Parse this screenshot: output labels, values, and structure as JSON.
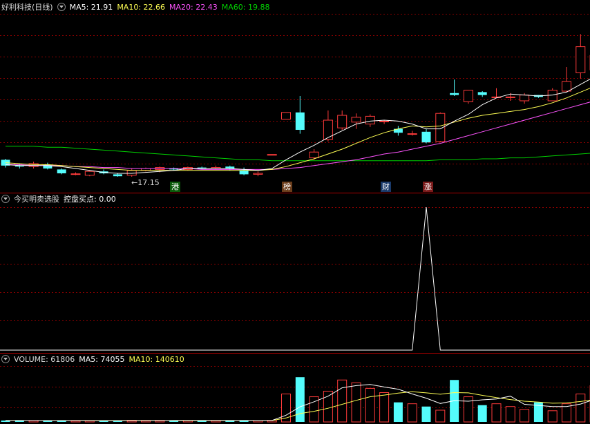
{
  "price_panel": {
    "title": "好利科技",
    "period": "(日线)",
    "ma5": "MA5: 21.91",
    "ma10": "MA10: 22.66",
    "ma20": "MA20: 22.43",
    "ma60": "MA60: 19.88",
    "low_label": "←17.15",
    "tags": [
      "港",
      "榜",
      "财",
      "涨"
    ]
  },
  "indicator_panel": {
    "name": "今买明卖选股",
    "value_label": "控盘买点: 0.00"
  },
  "volume_panel": {
    "volume": "VOLUME: 61806",
    "ma5": "MA5: 74055",
    "ma10": "MA10: 140610"
  },
  "colors": {
    "up": "#ff3b3b",
    "down": "#54fcfc",
    "ma5": "#ffffff",
    "ma10": "#ffff54",
    "ma20": "#ff54ff",
    "ma60": "#00d200",
    "grid": "#8a0000"
  },
  "chart_data": {
    "type": "candlestick",
    "ohlc": [
      [
        18.9,
        18.3,
        18.1,
        19.0
      ],
      [
        18.3,
        18.2,
        18.0,
        18.5
      ],
      [
        18.2,
        18.5,
        18.0,
        18.7
      ],
      [
        18.4,
        18.0,
        17.9,
        18.6
      ],
      [
        17.9,
        17.5,
        17.4,
        18.0
      ],
      [
        17.4,
        17.45,
        17.3,
        17.6
      ],
      [
        17.3,
        17.7,
        17.2,
        17.8
      ],
      [
        17.7,
        17.5,
        17.4,
        17.9
      ],
      [
        17.4,
        17.2,
        17.15,
        17.5
      ],
      [
        17.3,
        17.8,
        17.15,
        18.0
      ],
      [
        17.8,
        18.0,
        17.7,
        18.1
      ],
      [
        17.9,
        18.1,
        17.6,
        18.2
      ],
      [
        18.0,
        17.9,
        17.8,
        18.1
      ],
      [
        17.9,
        18.1,
        17.8,
        18.2
      ],
      [
        18.1,
        18.0,
        17.9,
        18.2
      ],
      [
        18.0,
        18.1,
        17.9,
        18.3
      ],
      [
        18.2,
        18.0,
        17.8,
        18.3
      ],
      [
        17.8,
        17.4,
        17.3,
        18.1
      ],
      [
        17.4,
        17.5,
        17.2,
        17.7
      ],
      [
        19.4,
        19.45,
        19.4,
        19.45
      ],
      [
        23.1,
        23.8,
        23.1,
        23.8
      ],
      [
        23.8,
        22.0,
        21.6,
        25.5
      ],
      [
        19.1,
        19.7,
        18.9,
        20.0
      ],
      [
        21.0,
        23.0,
        20.8,
        24.0
      ],
      [
        22.2,
        23.5,
        22.0,
        24.0
      ],
      [
        22.8,
        23.3,
        22.1,
        23.7
      ],
      [
        22.6,
        23.4,
        22.3,
        23.6
      ],
      [
        22.9,
        22.9,
        22.6,
        23.0
      ],
      [
        22.1,
        21.7,
        21.4,
        22.4
      ],
      [
        21.6,
        21.6,
        21.4,
        21.9
      ],
      [
        21.8,
        20.7,
        20.6,
        22.1
      ],
      [
        20.8,
        23.7,
        20.7,
        23.8
      ],
      [
        25.8,
        25.6,
        25.5,
        27.2
      ],
      [
        24.9,
        26.1,
        24.7,
        26.1
      ],
      [
        25.9,
        25.6,
        25.4,
        26.0
      ],
      [
        25.4,
        25.4,
        25.3,
        26.3
      ],
      [
        25.4,
        25.4,
        25.0,
        25.8
      ],
      [
        25.0,
        25.6,
        24.7,
        25.8
      ],
      [
        25.6,
        25.4,
        25.3,
        25.6
      ],
      [
        25.0,
        26.1,
        25.0,
        26.3
      ],
      [
        26.0,
        27.0,
        25.9,
        28.5
      ],
      [
        27.9,
        30.6,
        27.3,
        31.9
      ],
      [
        28.2,
        29.7,
        27.9,
        31.1
      ],
      [
        29.7,
        32.3,
        29.6,
        32.5
      ],
      [
        31.9,
        33.5,
        31.1,
        33.6
      ]
    ],
    "ma5_series": [
      18.4,
      18.3,
      18.3,
      18.3,
      18.2,
      18.0,
      17.8,
      17.6,
      17.5,
      17.5,
      17.6,
      17.7,
      17.8,
      18.0,
      18.0,
      18.0,
      18.0,
      17.9,
      17.8,
      18.0,
      18.9,
      19.7,
      20.4,
      21.2,
      21.9,
      22.6,
      22.9,
      23.0,
      22.9,
      22.6,
      22.1,
      22.1,
      22.9,
      23.6,
      24.6,
      25.3,
      25.7,
      25.6,
      25.5,
      25.6,
      25.9,
      26.7,
      27.5,
      28.4,
      29.6
    ],
    "ma10_series": [
      18.6,
      18.5,
      18.4,
      18.4,
      18.3,
      18.2,
      18.1,
      18.0,
      17.9,
      17.8,
      17.8,
      17.8,
      17.8,
      17.8,
      17.8,
      17.8,
      17.8,
      17.8,
      17.8,
      17.9,
      18.2,
      18.6,
      19.0,
      19.5,
      20.0,
      20.6,
      21.2,
      21.7,
      22.1,
      22.4,
      22.3,
      22.4,
      22.8,
      23.2,
      23.5,
      23.7,
      23.9,
      24.1,
      24.4,
      24.8,
      25.3,
      25.9,
      26.5,
      27.1,
      27.8
    ],
    "ma20_series": [
      18.4,
      18.4,
      18.3,
      18.3,
      18.3,
      18.2,
      18.2,
      18.1,
      18.1,
      18.0,
      18.0,
      18.0,
      18.0,
      18.0,
      17.9,
      17.9,
      17.9,
      17.9,
      17.9,
      17.9,
      18.0,
      18.1,
      18.3,
      18.5,
      18.7,
      18.9,
      19.2,
      19.5,
      19.7,
      20.0,
      20.3,
      20.6,
      21.0,
      21.4,
      21.8,
      22.2,
      22.6,
      23.0,
      23.4,
      23.8,
      24.2,
      24.6,
      25.0,
      25.5,
      26.0
    ],
    "ma60_series": [
      20.3,
      20.3,
      20.3,
      20.2,
      20.2,
      20.1,
      20.0,
      19.9,
      19.8,
      19.7,
      19.6,
      19.5,
      19.4,
      19.3,
      19.2,
      19.1,
      19.0,
      18.9,
      18.9,
      18.8,
      18.8,
      18.8,
      18.8,
      18.8,
      18.8,
      18.8,
      18.8,
      18.8,
      18.8,
      18.8,
      18.8,
      18.9,
      18.9,
      18.9,
      19.0,
      19.0,
      19.1,
      19.1,
      19.2,
      19.3,
      19.4,
      19.5,
      19.6,
      19.7,
      19.9
    ],
    "indicator_values": [
      0,
      0,
      0,
      0,
      0,
      0,
      0,
      0,
      0,
      0,
      0,
      0,
      0,
      0,
      0,
      0,
      0,
      0,
      0,
      0,
      0,
      0,
      0,
      0,
      0,
      0,
      0,
      0,
      0,
      0,
      1,
      0,
      0,
      0,
      0,
      0,
      0,
      0,
      0,
      0,
      0,
      0,
      0,
      0,
      0
    ],
    "volume": [
      5000,
      4500,
      5500,
      4800,
      4000,
      3600,
      4200,
      4000,
      3800,
      6000,
      5500,
      5800,
      4800,
      5000,
      5200,
      5500,
      5000,
      4900,
      5000,
      6000,
      100000,
      160000,
      90000,
      110000,
      150000,
      140000,
      120000,
      105000,
      70000,
      65000,
      55000,
      42000,
      150000,
      90000,
      60000,
      65000,
      55000,
      45000,
      70000,
      40000,
      65000,
      100000,
      130000,
      190000,
      170000
    ],
    "volume_ma5": [
      5000,
      5000,
      4900,
      4800,
      4800,
      4600,
      4500,
      4300,
      4100,
      4300,
      4500,
      4800,
      5100,
      5400,
      5200,
      5300,
      5100,
      5200,
      5100,
      5300,
      24000,
      54000,
      72000,
      92000,
      122000,
      130000,
      134000,
      125000,
      117000,
      100000,
      85000,
      66000,
      76000,
      74000,
      79000,
      82000,
      92000,
      63000,
      59000,
      55000,
      55000,
      64000,
      81000,
      105000,
      129000
    ],
    "volume_ma10": [
      5200,
      5100,
      5000,
      5000,
      4900,
      4900,
      4800,
      4700,
      4600,
      4600,
      4600,
      4700,
      4700,
      4700,
      4800,
      4800,
      4800,
      4900,
      4900,
      5000,
      14000,
      30000,
      38000,
      49000,
      63000,
      77000,
      90000,
      96000,
      103000,
      108000,
      104000,
      99000,
      105000,
      104000,
      95000,
      87000,
      80000,
      74000,
      71000,
      67000,
      68000,
      73000,
      80000,
      92000,
      101000
    ]
  }
}
